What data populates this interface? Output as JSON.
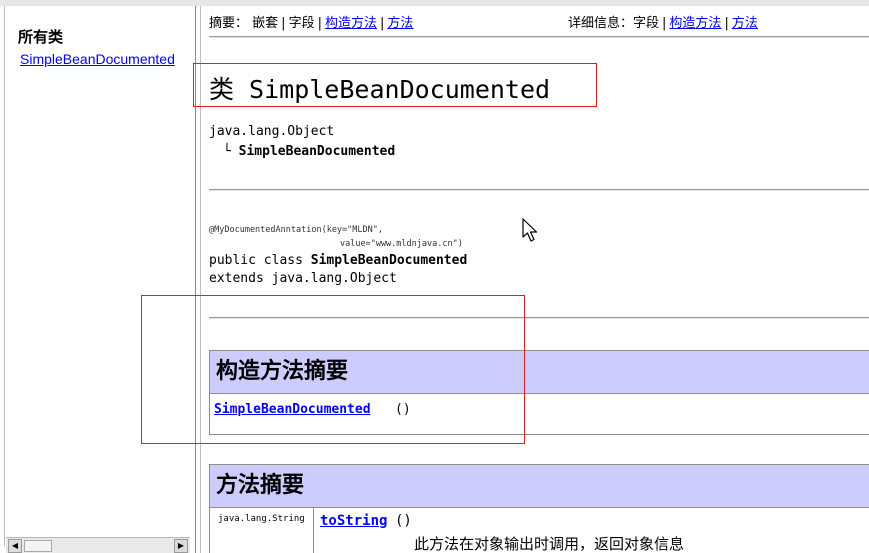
{
  "left_frame": {
    "title": "所有类",
    "class_links": [
      "SimpleBeanDocumented"
    ],
    "scroll_left": "◀",
    "scroll_right": "▶"
  },
  "nav": {
    "summary_label": "摘要：",
    "nested": "嵌套",
    "field": "字段",
    "constructor": "构造方法",
    "method": "方法",
    "detail_label": "详细信息：",
    "detail_field": "字段",
    "detail_constructor": "构造方法",
    "detail_method": "方法",
    "sep": "|"
  },
  "class_header": {
    "title": "类 SimpleBeanDocumented"
  },
  "hierarchy": {
    "parent": "java.lang.Object",
    "connector": "└",
    "child": "SimpleBeanDocumented"
  },
  "declaration": {
    "annotation_line1": "@MyDocumentedAnntation(key=\"MLDN\",",
    "annotation_line2": "value=\"www.mldnjava.cn\")",
    "decl_prefix": "public class ",
    "decl_name": "SimpleBeanDocumented",
    "extends_line": "extends java.lang.Object"
  },
  "constructor_summary": {
    "heading": "构造方法摘要",
    "rows": [
      {
        "name": "SimpleBeanDocumented",
        "params": "()"
      }
    ]
  },
  "method_summary": {
    "heading": "方法摘要",
    "rows": [
      {
        "return_type": "java.lang.String",
        "name": "toString",
        "params": "()",
        "description": "此方法在对象输出时调用，返回对象信息"
      }
    ]
  },
  "colors": {
    "table_header_bg": "#ccccff",
    "link": "#0000ff",
    "annotation_box": "#e81c1c"
  }
}
